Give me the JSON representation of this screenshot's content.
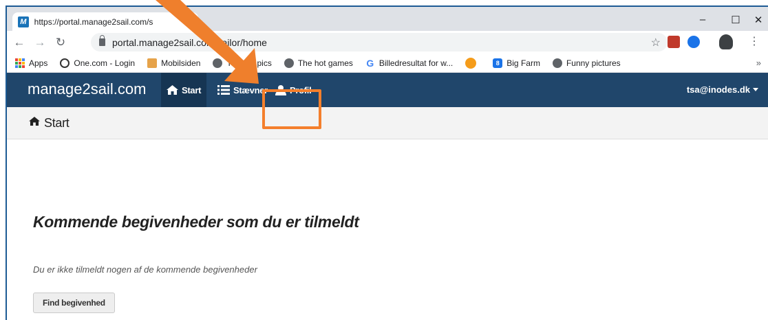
{
  "browser": {
    "tab_title": "https://portal.manage2sail.com/s",
    "favicon_text": "M",
    "url": "portal.manage2sail.com/sailor/home",
    "window_controls": [
      "–",
      "☐",
      "✕"
    ]
  },
  "bookmarks": [
    {
      "label": "Apps",
      "icon": "apps-grid-icon"
    },
    {
      "label": "One.com - Login",
      "icon": "onecom-icon"
    },
    {
      "label": "Mobilsiden",
      "icon": "mobilsiden-icon"
    },
    {
      "label": "The hot pics",
      "icon": "globe-icon"
    },
    {
      "label": "The hot games",
      "icon": "globe-icon"
    },
    {
      "label": "Billedresultat for w...",
      "icon": "google-icon"
    },
    {
      "label": "",
      "icon": "sun-icon"
    },
    {
      "label": "Big Farm",
      "icon": "bigfarm-icon"
    },
    {
      "label": "Funny pictures",
      "icon": "globe-icon"
    }
  ],
  "site": {
    "brand": "manage2sail.com",
    "nav": {
      "start": "Start",
      "staevner": "Stævner",
      "profil": "Profil"
    },
    "user": "tsa@inodes.dk",
    "nav_color": "#20466b",
    "highlight_color": "#f47f2c"
  },
  "page": {
    "breadcrumb": "Start",
    "heading": "Kommende begivenheder som du er tilmeldt",
    "empty_message": "Du er ikke tilmeldt nogen af de kommende begivenheder",
    "button": "Find begivenhed"
  }
}
